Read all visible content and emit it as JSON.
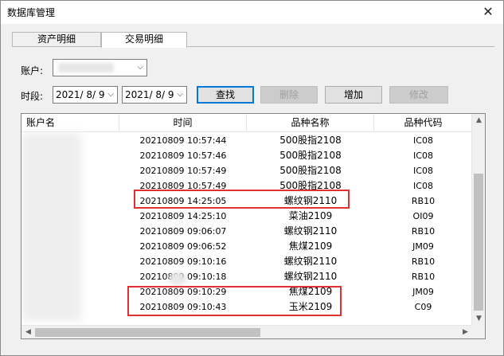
{
  "window": {
    "title": "数据库管理",
    "close_glyph": "✕"
  },
  "tabs": [
    {
      "label": "资产明细"
    },
    {
      "label": "交易明细"
    }
  ],
  "selected_tab": "交易明细",
  "form": {
    "account_label": "账户:",
    "period_label": "时段:",
    "date_from": "2021/ 8/ 9",
    "date_to": "2021/ 8/ 9"
  },
  "buttons": {
    "query": "查找",
    "delete": "删除",
    "add": "增加",
    "modify": "修改"
  },
  "table": {
    "columns": [
      "账户名",
      "时间",
      "品种名称",
      "品种代码"
    ],
    "rows": [
      {
        "time": "20210809 10:57:44",
        "name": "500股指2108",
        "code": "IC08"
      },
      {
        "time": "20210809 10:57:46",
        "name": "500股指2108",
        "code": "IC08"
      },
      {
        "time": "20210809 10:57:49",
        "name": "500股指2108",
        "code": "IC08"
      },
      {
        "time": "20210809 10:57:49",
        "name": "500股指2108",
        "code": "IC08"
      },
      {
        "time": "20210809 14:25:05",
        "name": "螺纹钢2110",
        "code": "RB10"
      },
      {
        "time": "20210809 14:25:10",
        "name": "菜油2109",
        "code": "OI09"
      },
      {
        "time": "20210809 09:06:07",
        "name": "螺纹钢2110",
        "code": "RB10"
      },
      {
        "time": "20210809 09:06:52",
        "name": "焦煤2109",
        "code": "JM09"
      },
      {
        "time": "20210809 09:10:16",
        "name": "螺纹钢2110",
        "code": "RB10"
      },
      {
        "time": "20210809 09:10:18",
        "name": "螺纹钢2110",
        "code": "RB10"
      },
      {
        "time": "20210809 09:10:29",
        "name": "焦煤2109",
        "code": "JM09"
      },
      {
        "time": "20210809 09:10:43",
        "name": "玉米2109",
        "code": "C09"
      }
    ]
  },
  "colors": {
    "highlight": "#e03030",
    "focus_border": "#0078d7"
  }
}
